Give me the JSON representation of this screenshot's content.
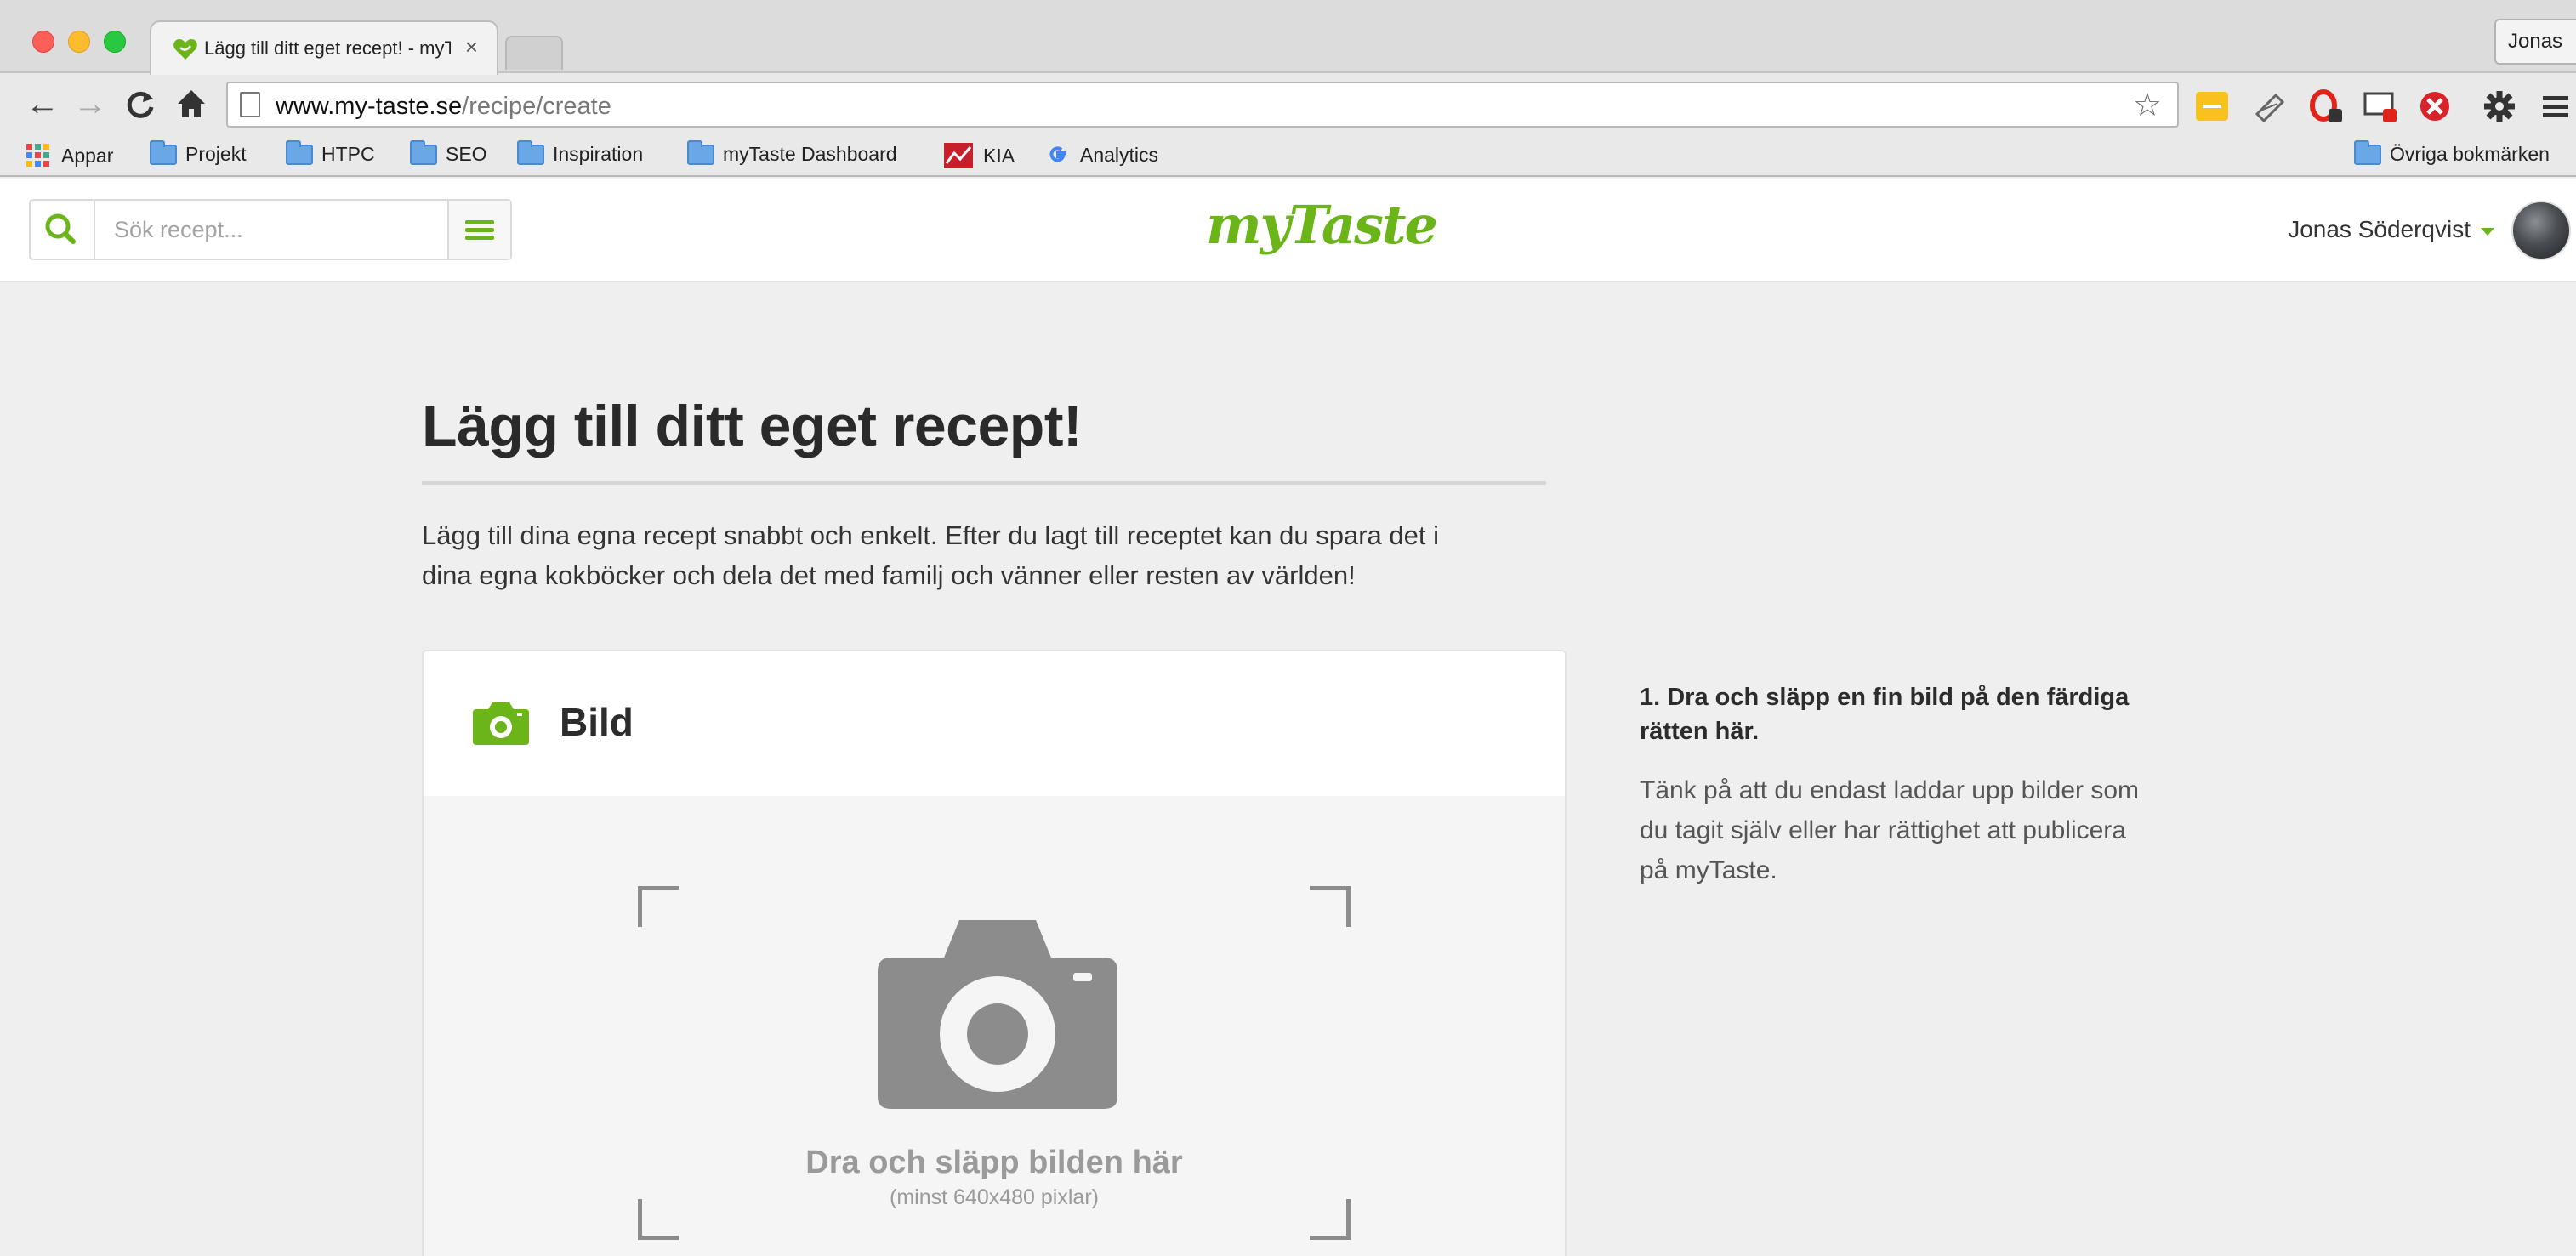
{
  "browser": {
    "tab_title": "Lägg till ditt eget recept! - myTaste",
    "tab_close": "×",
    "profile": "Jonas",
    "url_host": "www.my-taste.se",
    "url_path": "/recipe/create",
    "bookmarks": [
      {
        "label": "Appar",
        "icon": "apps-grid-icon"
      },
      {
        "label": "Projekt",
        "icon": "folder-icon"
      },
      {
        "label": "HTPC",
        "icon": "folder-icon"
      },
      {
        "label": "SEO",
        "icon": "folder-icon"
      },
      {
        "label": "Inspiration",
        "icon": "folder-icon"
      },
      {
        "label": "myTaste Dashboard",
        "icon": "folder-icon"
      },
      {
        "label": "KIA",
        "icon": "kia-chart-icon"
      },
      {
        "label": "Analytics",
        "icon": "google-icon"
      },
      {
        "label": "Övriga bokmärken",
        "icon": "folder-icon"
      }
    ],
    "extensions": [
      "ext-yellow-icon",
      "ext-scroll-icon",
      "opera-icon",
      "screen-capture-icon",
      "block-icon",
      "gear-icon",
      "hamburger-menu-icon"
    ]
  },
  "header": {
    "search_placeholder": "Sök recept...",
    "logo": "myTaste",
    "user_name": "Jonas Söderqvist"
  },
  "main": {
    "title": "Lägg till ditt eget recept!",
    "intro_line1": "Lägg till dina egna recept snabbt och enkelt. Efter du lagt till receptet kan du spara det i",
    "intro_line2": "dina egna kokböcker och dela det med familj och vänner eller resten av världen!",
    "card": {
      "title": "Bild",
      "drop_text": "Dra och släpp bilden här",
      "drop_subtext": "(minst 640x480 pixlar)"
    },
    "side": {
      "heading": "1. Dra och släpp en fin bild på den färdiga rätten här.",
      "text": "Tänk på att du endast laddar upp bilder som du tagit själv eller har rättighet att publicera på myTaste."
    }
  },
  "colors": {
    "accent": "#6bb51b",
    "page_bg": "#efefef",
    "dropzone_bg": "#f5f5f5",
    "placeholder_gray": "#8c8c8c"
  }
}
